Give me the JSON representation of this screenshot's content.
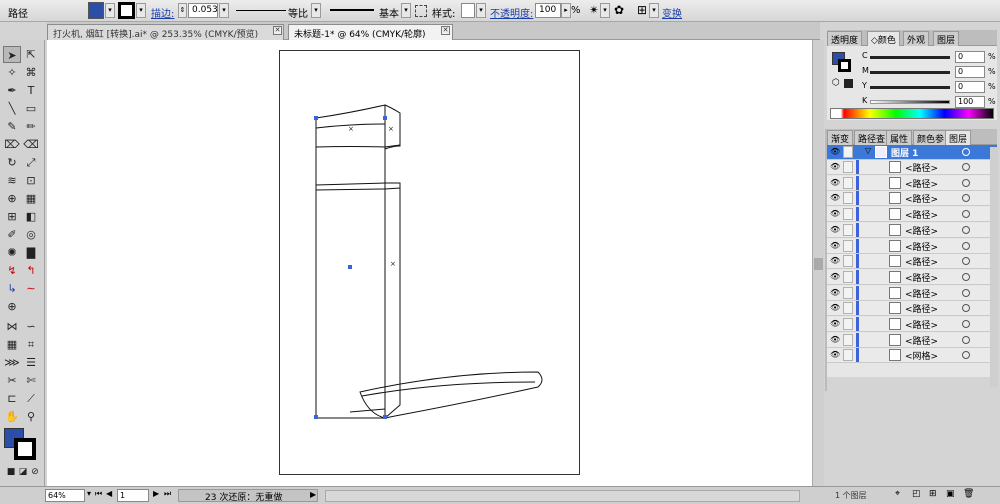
{
  "control_bar": {
    "selection_label": "路径",
    "stroke_label": "描边:",
    "stroke_weight": "0.053",
    "stroke_profile": "等比",
    "brush_label": "基本",
    "style_label": "样式:",
    "opacity_label": "不透明度:",
    "opacity_value": "100",
    "opacity_unit": "%",
    "transform_label": "变换"
  },
  "doc_tabs": [
    {
      "label": "打火机, 烟缸 [转换].ai* @ 253.35% (CMYK/预览)",
      "active": false
    },
    {
      "label": "未标题-1* @ 64% (CMYK/轮廓)",
      "active": true
    }
  ],
  "color_panel": {
    "tabs": [
      "透明度",
      "◇颜色",
      "外观",
      "图层"
    ],
    "channels": [
      {
        "name": "C",
        "value": "0",
        "unit": "%"
      },
      {
        "name": "M",
        "value": "0",
        "unit": "%"
      },
      {
        "name": "Y",
        "value": "0",
        "unit": "%"
      },
      {
        "name": "K",
        "value": "100",
        "unit": "%"
      }
    ]
  },
  "layers_panel": {
    "tabs": [
      "渐变",
      "路径查",
      "属性",
      "颜色参",
      "图层"
    ],
    "layer_name": "图层 1",
    "rows": [
      {
        "label": "<路径>",
        "thumb": "icon-1"
      },
      {
        "label": "<路径>",
        "thumb": "icon-2"
      },
      {
        "label": "<路径>",
        "thumb": "icon-3"
      },
      {
        "label": "<路径>",
        "thumb": "icon-4"
      },
      {
        "label": "<路径>",
        "thumb": "icon-5"
      },
      {
        "label": "<路径>",
        "thumb": "icon-6"
      },
      {
        "label": "<路径>",
        "thumb": "icon-7"
      },
      {
        "label": "<路径>",
        "thumb": "icon-8"
      },
      {
        "label": "<路径>",
        "thumb": "icon-9"
      },
      {
        "label": "<路径>",
        "thumb": "icon-10"
      },
      {
        "label": "<路径>",
        "thumb": "icon-11"
      },
      {
        "label": "<路径>",
        "thumb": "icon-12"
      },
      {
        "label": "<网格>",
        "thumb": "icon-13"
      }
    ],
    "footer_label": "1 个图层"
  },
  "status_bar": {
    "zoom": "64%",
    "page": "1",
    "status_text": "23 次还原：无重做"
  },
  "colors": {
    "fill_swatch": "#2b4fa8",
    "layer_color": "#3c64d8",
    "accent_link": "#1a3ea8"
  }
}
